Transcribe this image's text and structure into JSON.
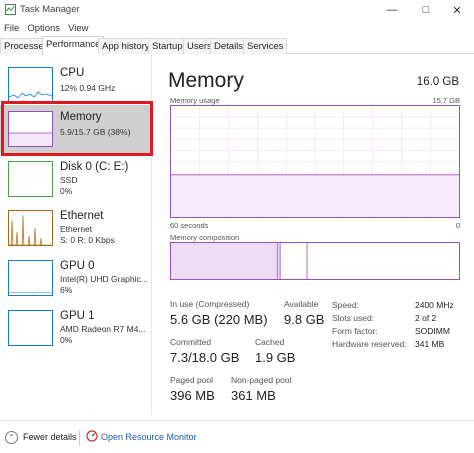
{
  "window": {
    "title": "Task Manager"
  },
  "menu": [
    "File",
    "Options",
    "View"
  ],
  "tabs": [
    "Processes",
    "Performance",
    "App history",
    "Startup",
    "Users",
    "Details",
    "Services"
  ],
  "active_tab": "Performance",
  "sidebar": {
    "items": [
      {
        "name": "CPU",
        "sub1": "12% 0.94 GHz",
        "sub2": "",
        "color": "#1a7dc4",
        "selected": false
      },
      {
        "name": "Memory",
        "sub1": "5.9/15.7 GB (38%)",
        "sub2": "",
        "color": "#9b4fbf",
        "selected": true
      },
      {
        "name": "Disk 0 (C: E:)",
        "sub1": "SSD",
        "sub2": "0%",
        "color": "#4ca24c",
        "selected": false
      },
      {
        "name": "Ethernet",
        "sub1": "Ethernet",
        "sub2": "S: 0 R: 0 Kbps",
        "color": "#a86518",
        "selected": false
      },
      {
        "name": "GPU 0",
        "sub1": "Intel(R) UHD Graphic...",
        "sub2": "6%",
        "color": "#1a7dc4",
        "selected": false
      },
      {
        "name": "GPU 1",
        "sub1": "AMD Radeon R7 M4...",
        "sub2": "0%",
        "color": "#1a7dc4",
        "selected": false
      }
    ]
  },
  "main": {
    "heading": "Memory",
    "total": "16.0 GB",
    "usage_label": "Memory usage",
    "usage_max": "15.7 GB",
    "usage_fraction": 0.38,
    "time_label": "60 seconds",
    "time_end": "0",
    "composition_label": "Memory composition",
    "stats": {
      "in_use_label": "In use (Compressed)",
      "in_use_value": "5.6 GB (220 MB)",
      "available_label": "Available",
      "available_value": "9.8 GB",
      "committed_label": "Committed",
      "committed_value": "7.3/18.0 GB",
      "cached_label": "Cached",
      "cached_value": "1.9 GB",
      "paged_label": "Paged pool",
      "paged_value": "396 MB",
      "nonpaged_label": "Non-paged pool",
      "nonpaged_value": "361 MB"
    },
    "specs": [
      {
        "label": "Speed:",
        "value": "2400 MHz"
      },
      {
        "label": "Slots used:",
        "value": "2 of 2"
      },
      {
        "label": "Form factor:",
        "value": "SODIMM"
      },
      {
        "label": "Hardware reserved:",
        "value": "341 MB"
      }
    ]
  },
  "footer": {
    "fewer_details": "Fewer details",
    "resource_monitor": "Open Resource Monitor"
  },
  "colors": {
    "memory": "#9b4fbf",
    "memory_fill": "#f3e8f8",
    "highlight": "#e0181f",
    "link": "#1a5fb4"
  }
}
